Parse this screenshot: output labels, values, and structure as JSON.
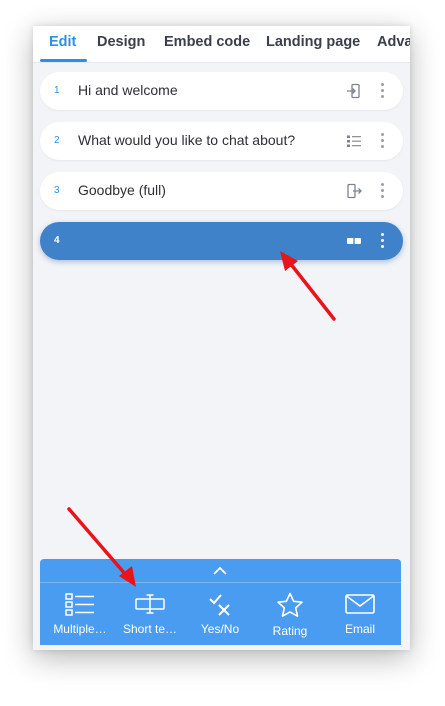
{
  "tabs": [
    {
      "label": "Edit",
      "active": true
    },
    {
      "label": "Design"
    },
    {
      "label": "Embed code"
    },
    {
      "label": "Landing page"
    },
    {
      "label": "Adva"
    }
  ],
  "questions": [
    {
      "number": "1",
      "label": "Hi and welcome",
      "icon": "welcome-screen-icon"
    },
    {
      "number": "2",
      "label": "What would you like to chat about?",
      "icon": "multiple-choice-icon"
    },
    {
      "number": "3",
      "label": "Goodbye (full)",
      "icon": "end-screen-icon"
    },
    {
      "number": "4",
      "label": "",
      "icon": "short-text-icon",
      "selected": true
    }
  ],
  "question_types": [
    {
      "label": "Multiple…",
      "icon": "multiple-choice-icon"
    },
    {
      "label": "Short te…",
      "icon": "short-text-icon"
    },
    {
      "label": "Yes/No",
      "icon": "yes-no-icon"
    },
    {
      "label": "Rating",
      "icon": "star-icon"
    },
    {
      "label": "Email",
      "icon": "envelope-icon"
    }
  ],
  "colors": {
    "accent": "#2f8ee5",
    "selected_row": "#3f82c9",
    "panel": "#4a9cf0",
    "annotation_arrow": "#e8141c"
  }
}
